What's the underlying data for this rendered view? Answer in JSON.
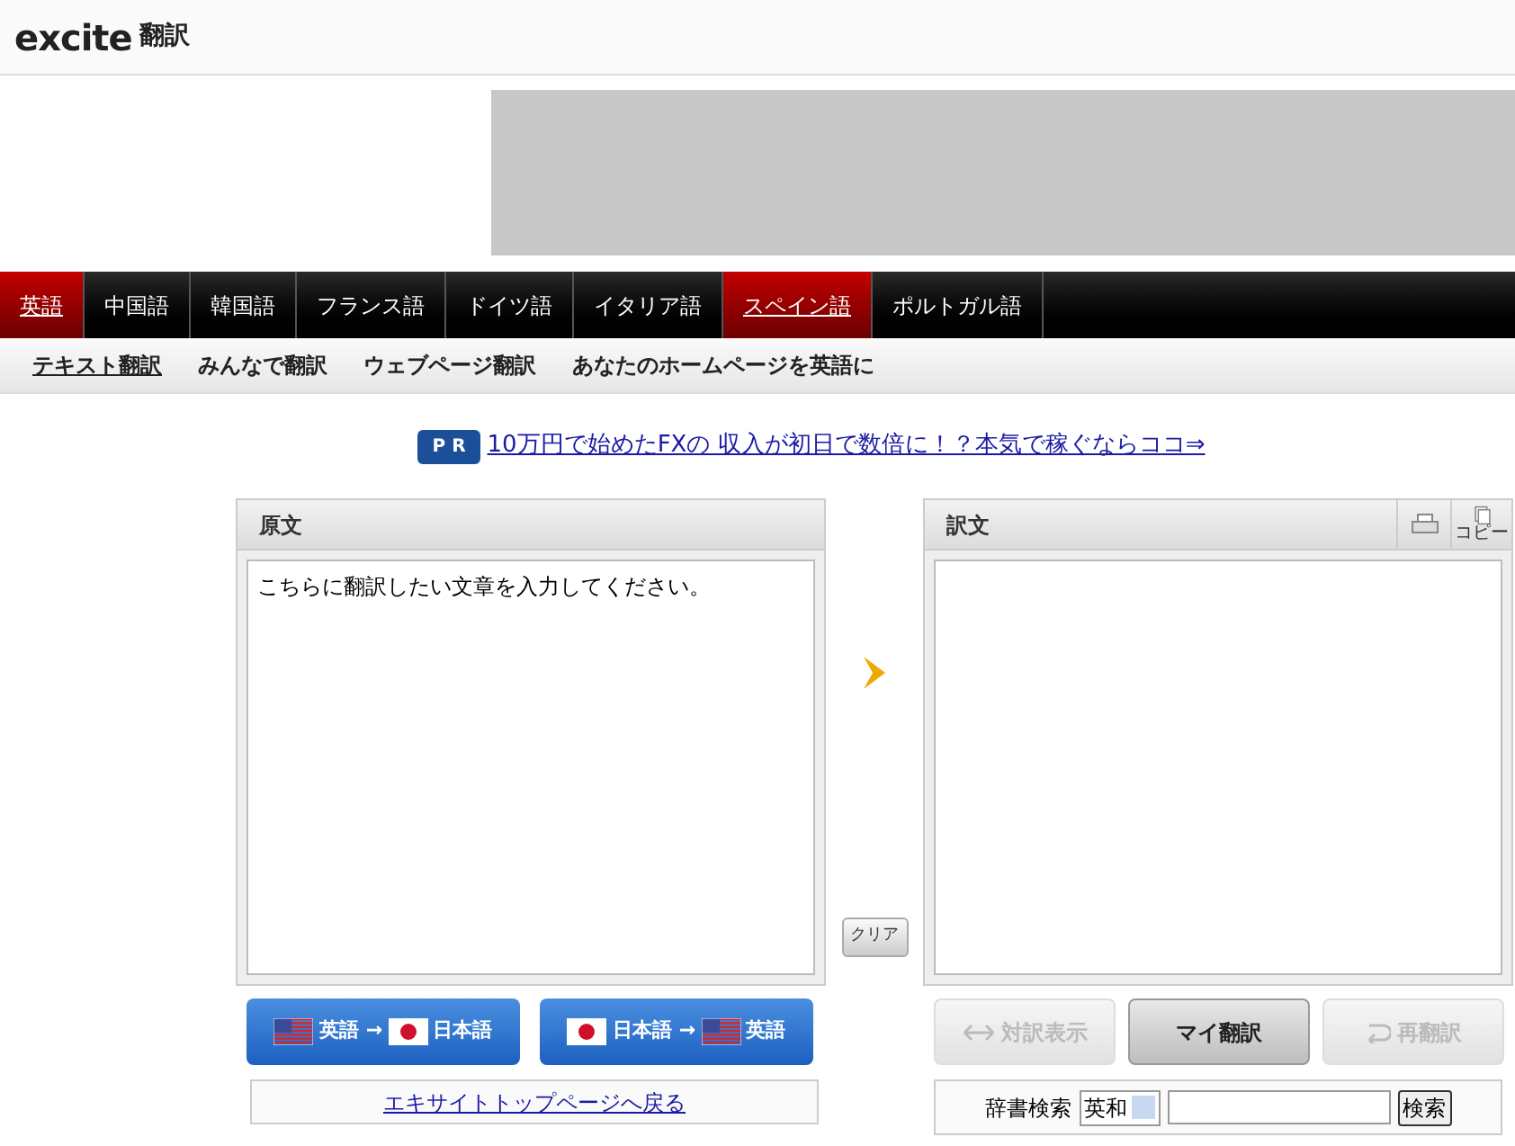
{
  "header": {
    "logo": "excite",
    "logo_suffix": "翻訳"
  },
  "language_tabs": [
    {
      "label": "英語",
      "selected": true
    },
    {
      "label": "中国語",
      "selected": false
    },
    {
      "label": "韓国語",
      "selected": false
    },
    {
      "label": "フランス語",
      "selected": false
    },
    {
      "label": "ドイツ語",
      "selected": false
    },
    {
      "label": "イタリア語",
      "selected": false
    },
    {
      "label": "スペイン語",
      "selected": true
    },
    {
      "label": "ポルトガル語",
      "selected": false
    }
  ],
  "sub_tabs": [
    {
      "label": "テキスト翻訳",
      "selected": true
    },
    {
      "label": "みんなで翻訳",
      "selected": false
    },
    {
      "label": "ウェブページ翻訳",
      "selected": false
    },
    {
      "label": "あなたのホームページを英語に",
      "selected": false
    }
  ],
  "promo": {
    "badge": "P R",
    "link": "10万円で始めたFXの 収入が初日で数倍に！？本気で稼ぐならココ⇒"
  },
  "source_panel": {
    "title": "原文",
    "text": "こちらに翻訳したい文章を入力してください。"
  },
  "clear_button": "クリア",
  "target_panel": {
    "title": "訳文",
    "copy_label": "コピー"
  },
  "direction_buttons": [
    {
      "from": {
        "kind": "us",
        "label": "英語"
      },
      "arrow": "→",
      "to": {
        "kind": "jp",
        "label": "日本語"
      }
    },
    {
      "from": {
        "kind": "jp",
        "label": "日本語"
      },
      "arrow": "→",
      "to": {
        "kind": "us",
        "label": "英語"
      }
    }
  ],
  "back_link": "エキサイトトップページへ戻る",
  "action_buttons": [
    {
      "label": "対訳表示",
      "kind": "parallel",
      "disabled": true
    },
    {
      "label": "マイ翻訳",
      "kind": "plain",
      "disabled": false
    },
    {
      "label": "再翻訳",
      "kind": "retranslate",
      "disabled": true
    }
  ],
  "dictionary": {
    "label": "辞書検索",
    "mode": "英和",
    "button": "検索"
  }
}
